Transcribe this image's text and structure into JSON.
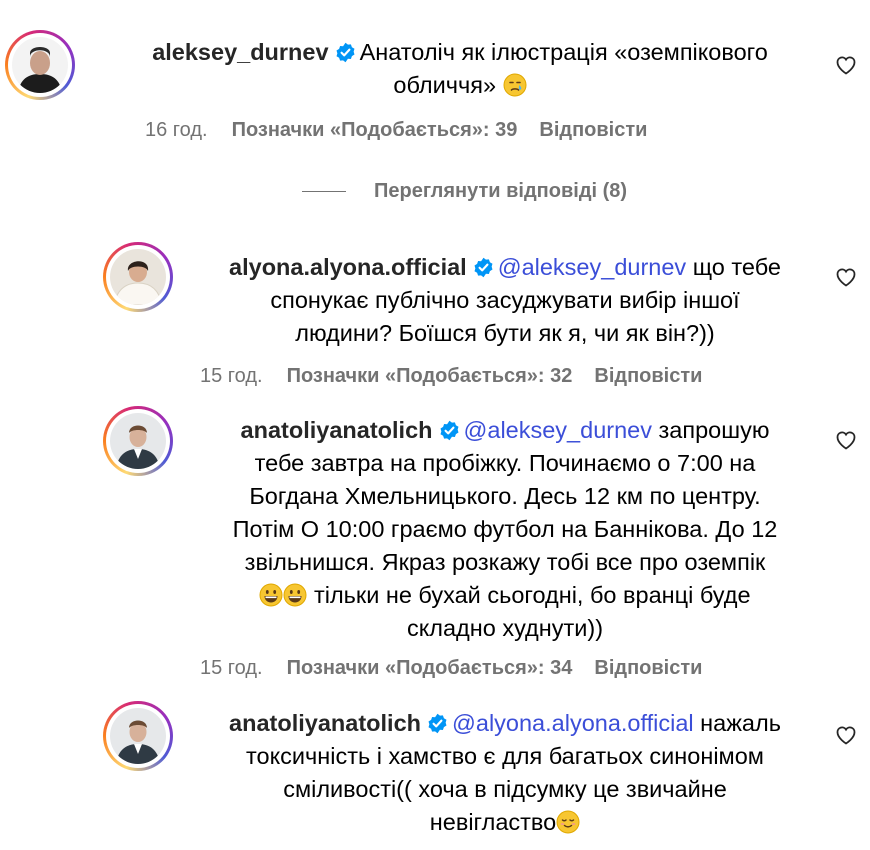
{
  "comments": [
    {
      "username": "aleksey_durnev",
      "text_line1": "Анатоліч як ілюстрація «оземпікового",
      "text_line2": "обличчя»",
      "time": "16 год.",
      "likes": "Позначки «Подобається»: 39",
      "reply": "Відповісти",
      "avatar_icon": "man-dark-hoodie-avatar"
    },
    {
      "username": "alyona.alyona.official",
      "mention": "@aleksey_durnev",
      "text_a": "що тебе",
      "text_line2": "спонукає публічно засуджувати вибір іншої",
      "text_line3": "людини? Боїшся бути як я, чи як він?))",
      "time": "15 год.",
      "likes": "Позначки «Подобається»: 32",
      "reply": "Відповісти",
      "avatar_icon": "woman-white-dress-avatar"
    },
    {
      "username": "anatoliyanatolich",
      "mention": "@aleksey_durnev",
      "text_a": "запрошую",
      "text_line2": "тебе завтра на пробіжку. Починаємо о 7:00 на",
      "text_line3": "Богдана Хмельницького. Десь 12 км по центру.",
      "text_line4": "Потім О 10:00 граємо футбол на Баннікова. До 12",
      "text_line5": "звільнишся. Якраз розкажу тобі все про оземпік",
      "text_line6": "тільки не бухай сьогодні, бо вранці буде",
      "text_line7": "складно худнути))",
      "time": "15 год.",
      "likes": "Позначки «Подобається»: 34",
      "reply": "Відповісти",
      "avatar_icon": "man-suit-avatar"
    },
    {
      "username": "anatoliyanatolich",
      "mention": "@alyona.alyona.official",
      "text_a": "нажаль",
      "text_line2": "токсичність і хамство є для багатьох синонімом",
      "text_line3": "сміливості(( хоча в підсумку це звичайне",
      "text_line4": "невігластво",
      "avatar_icon": "man-suit-avatar"
    }
  ],
  "view_replies": "Переглянути відповіді (8)",
  "colors": {
    "mention": "#3b4ed8",
    "verified": "#0095f6",
    "meta": "#737373"
  }
}
